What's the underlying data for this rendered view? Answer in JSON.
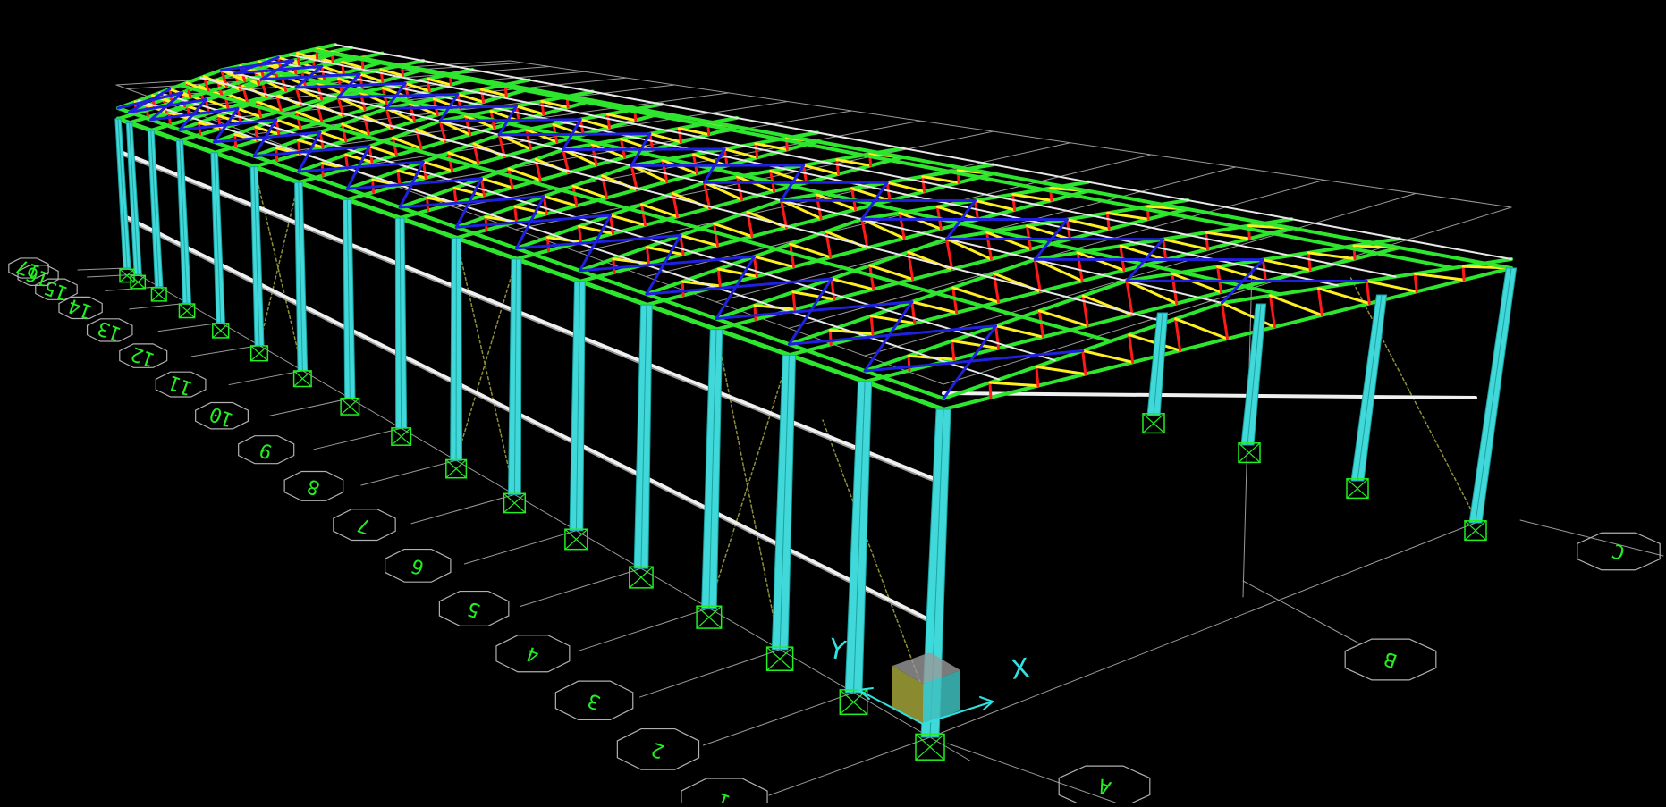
{
  "scene": {
    "background": "#000000",
    "bays_along_length": 16,
    "column_lines_per_row": 17,
    "colors": {
      "column": "#40d8d8",
      "column_edge": "#1aa3a3",
      "bottom_chord": "#2ee62e",
      "top_chord": "#2ee62e",
      "truss_vertical": "#ff1a1a",
      "truss_diagonal": "#ffee22",
      "roof_bracing": "#2020e0",
      "purlin": "#e8e8e8",
      "girt": "#f0f0f0",
      "wall_bracing": "#8f8f3a",
      "grid_line": "#9a9a9a",
      "support": "#22ee22",
      "bubble_outline": "#b0b0b0",
      "bubble_text": "#22ee22",
      "axis": "#33e0e0",
      "origin_box_face": "#8a8a30",
      "origin_box_side": "#3fbfbf",
      "origin_box_top": "#9a9a9a"
    }
  },
  "grid_labels": {
    "numbered": [
      "1",
      "2",
      "3",
      "4",
      "5",
      "6",
      "7",
      "8",
      "9",
      "10",
      "11",
      "12",
      "13",
      "14",
      "15",
      "16",
      "17"
    ],
    "lettered": [
      "A",
      "B",
      "C"
    ]
  },
  "axes": {
    "x_label": "X",
    "y_label": "Y"
  }
}
